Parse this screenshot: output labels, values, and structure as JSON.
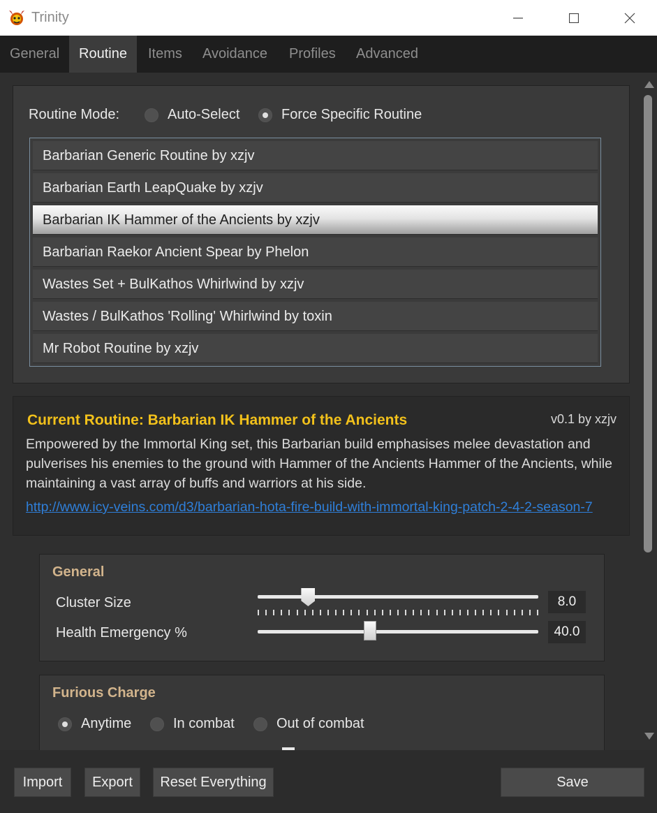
{
  "window": {
    "title": "Trinity",
    "app_icon": "trinity-demon-icon",
    "controls": [
      "minimize",
      "maximize",
      "close"
    ]
  },
  "tabs": [
    {
      "label": "General",
      "active": false
    },
    {
      "label": "Routine",
      "active": true
    },
    {
      "label": "Items",
      "active": false
    },
    {
      "label": "Avoidance",
      "active": false
    },
    {
      "label": "Profiles",
      "active": false
    },
    {
      "label": "Advanced",
      "active": false
    }
  ],
  "routine_mode": {
    "label": "Routine Mode:",
    "options": [
      {
        "label": "Auto-Select",
        "checked": false
      },
      {
        "label": "Force Specific Routine",
        "checked": true
      }
    ]
  },
  "routines": [
    {
      "label": "Barbarian Generic Routine by xzjv",
      "selected": false
    },
    {
      "label": "Barbarian Earth LeapQuake by xzjv",
      "selected": false
    },
    {
      "label": "Barbarian IK Hammer of the Ancients by xzjv",
      "selected": true
    },
    {
      "label": "Barbarian Raekor Ancient Spear by Phelon",
      "selected": false
    },
    {
      "label": "Wastes Set + BulKathos Whirlwind by xzjv",
      "selected": false
    },
    {
      "label": "Wastes / BulKathos 'Rolling' Whirlwind by toxin",
      "selected": false
    },
    {
      "label": "Mr Robot Routine by xzjv",
      "selected": false
    }
  ],
  "current_routine": {
    "title": "Current Routine: Barbarian IK Hammer of the Ancients",
    "version": "v0.1 by xzjv",
    "description": "Empowered by the Immortal King set, this Barbarian build emphasises melee devastation and pulverises his enemies to the ground with Hammer of the Ancients Hammer of the Ancients, while maintaining a vast array of buffs and warriors at his side.",
    "link": "http://www.icy-veins.com/d3/barbarian-hota-fire-build-with-immortal-king-patch-2-4-2-season-7"
  },
  "general_group": {
    "title": "General",
    "settings": [
      {
        "label": "Cluster Size",
        "value": "8.0",
        "fraction": 0.18,
        "ticked": true
      },
      {
        "label": "Health Emergency %",
        "value": "40.0",
        "fraction": 0.4,
        "ticked": false
      }
    ]
  },
  "furious_charge_group": {
    "title": "Furious Charge",
    "options": [
      {
        "label": "Anytime",
        "checked": true
      },
      {
        "label": "In combat",
        "checked": false
      },
      {
        "label": "Out of combat",
        "checked": false
      }
    ]
  },
  "buttons": {
    "import": "Import",
    "export": "Export",
    "reset": "Reset Everything",
    "save": "Save"
  }
}
